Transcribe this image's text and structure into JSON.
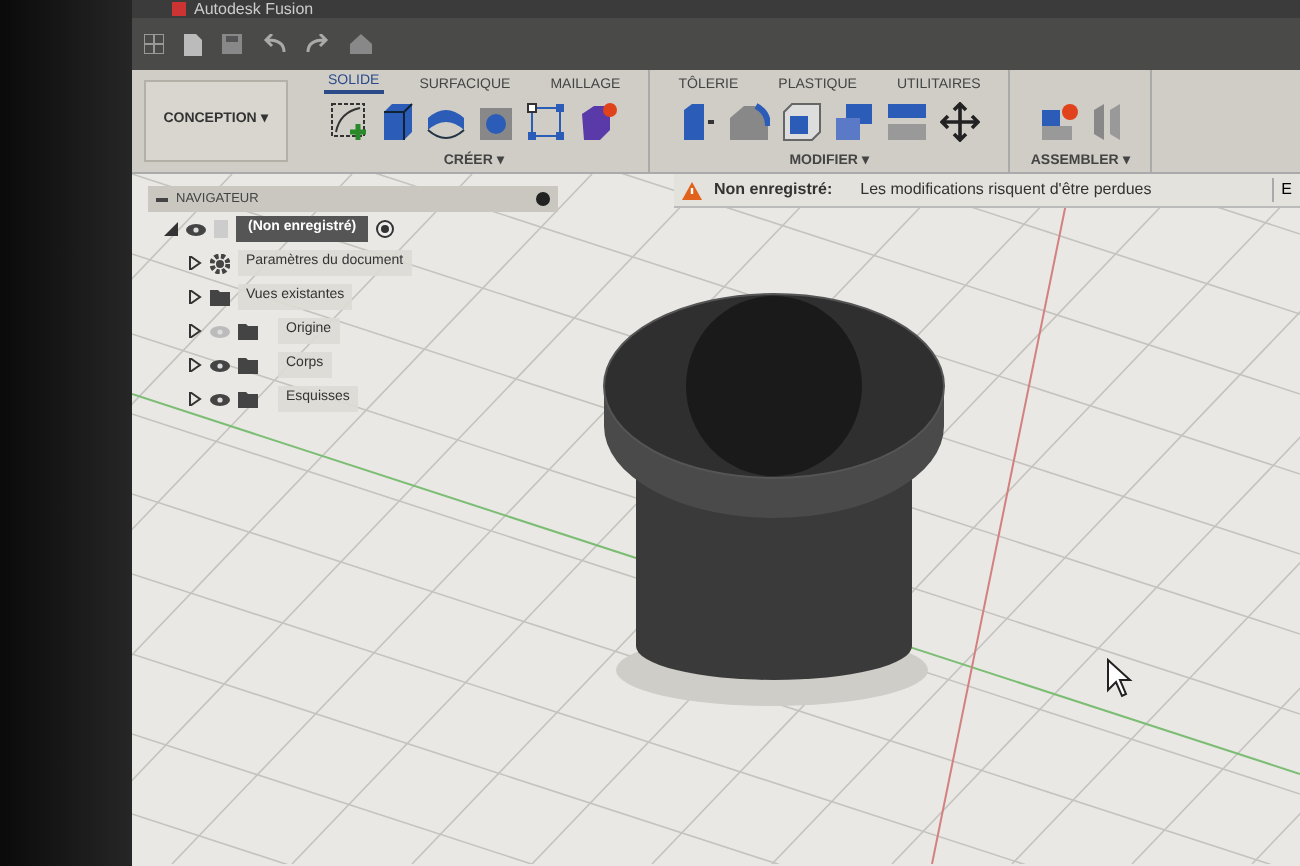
{
  "window": {
    "title": "Autodesk Fusion"
  },
  "workspace": {
    "label": "CONCEPTION ▾"
  },
  "tabs": [
    {
      "label": "SOLIDE",
      "selected": true
    },
    {
      "label": "SURFACIQUE",
      "selected": false
    },
    {
      "label": "MAILLAGE",
      "selected": false
    },
    {
      "label": "TÔLERIE",
      "selected": false
    },
    {
      "label": "PLASTIQUE",
      "selected": false
    },
    {
      "label": "UTILITAIRES",
      "selected": false
    }
  ],
  "groups": [
    {
      "label": "CRÉER ▾"
    },
    {
      "label": "MODIFIER ▾"
    },
    {
      "label": "ASSEMBLER ▾"
    }
  ],
  "notification": {
    "title": "Non enregistré:",
    "message": "Les modifications risquent d'être perdues",
    "action": "E"
  },
  "navigator": {
    "title": "NAVIGATEUR",
    "tree": {
      "label": "(Non enregistré)",
      "expanded": true,
      "children": [
        {
          "label": "Paramètres du document",
          "kind": "settings",
          "expanded": false
        },
        {
          "label": "Vues existantes",
          "kind": "folder",
          "expanded": false
        },
        {
          "label": "Origine",
          "kind": "layer",
          "visible": false,
          "expanded": false
        },
        {
          "label": "Corps",
          "kind": "layer",
          "visible": true,
          "expanded": false
        },
        {
          "label": "Esquisses",
          "kind": "layer",
          "visible": true,
          "expanded": false
        }
      ]
    }
  }
}
